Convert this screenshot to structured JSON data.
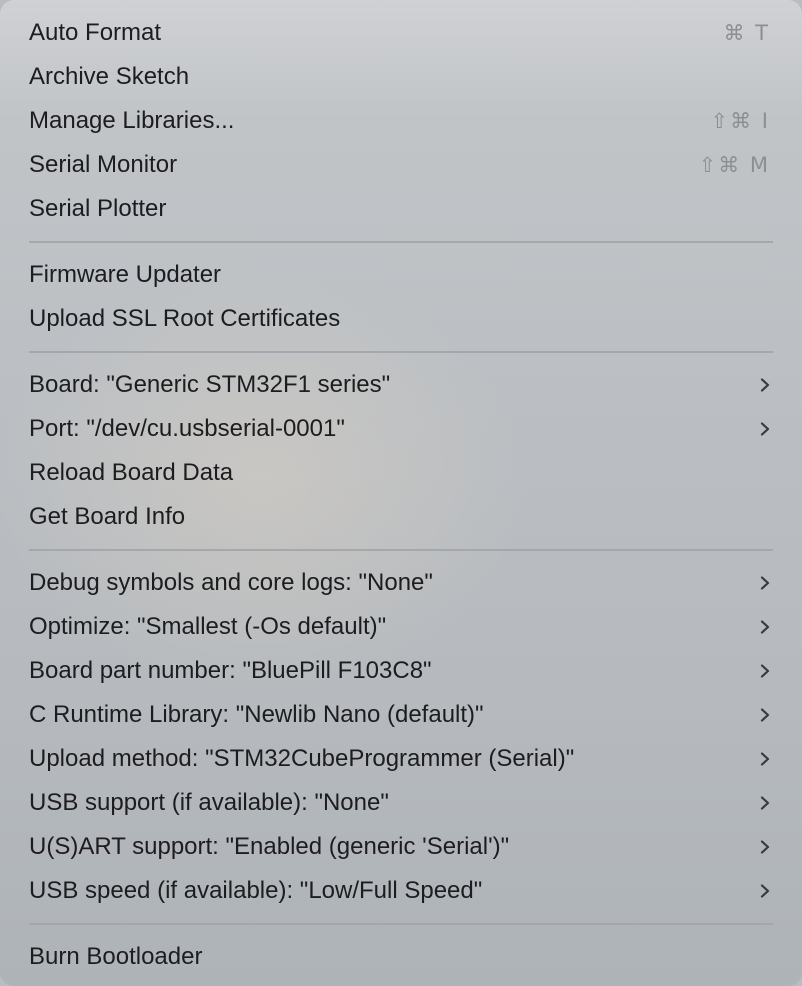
{
  "menu": {
    "groups": [
      [
        {
          "label": "Auto Format",
          "shortcut": "⌘ T"
        },
        {
          "label": "Archive Sketch"
        },
        {
          "label": "Manage Libraries...",
          "shortcut": "⇧⌘ I"
        },
        {
          "label": "Serial Monitor",
          "shortcut": "⇧⌘ M"
        },
        {
          "label": "Serial Plotter"
        }
      ],
      [
        {
          "label": "Firmware Updater"
        },
        {
          "label": "Upload SSL Root Certificates"
        }
      ],
      [
        {
          "label": "Board: \"Generic STM32F1 series\"",
          "submenu": true
        },
        {
          "label": "Port: \"/dev/cu.usbserial-0001\"",
          "submenu": true
        },
        {
          "label": "Reload Board Data"
        },
        {
          "label": "Get Board Info"
        }
      ],
      [
        {
          "label": "Debug symbols and core logs: \"None\"",
          "submenu": true
        },
        {
          "label": "Optimize: \"Smallest (-Os default)\"",
          "submenu": true
        },
        {
          "label": "Board part number: \"BluePill F103C8\"",
          "submenu": true
        },
        {
          "label": "C Runtime Library: \"Newlib Nano (default)\"",
          "submenu": true
        },
        {
          "label": "Upload method: \"STM32CubeProgrammer (Serial)\"",
          "submenu": true
        },
        {
          "label": "USB support (if available): \"None\"",
          "submenu": true
        },
        {
          "label": "U(S)ART support: \"Enabled (generic 'Serial')\"",
          "submenu": true
        },
        {
          "label": "USB speed (if available): \"Low/Full Speed\"",
          "submenu": true
        }
      ],
      [
        {
          "label": "Burn Bootloader"
        }
      ]
    ]
  }
}
